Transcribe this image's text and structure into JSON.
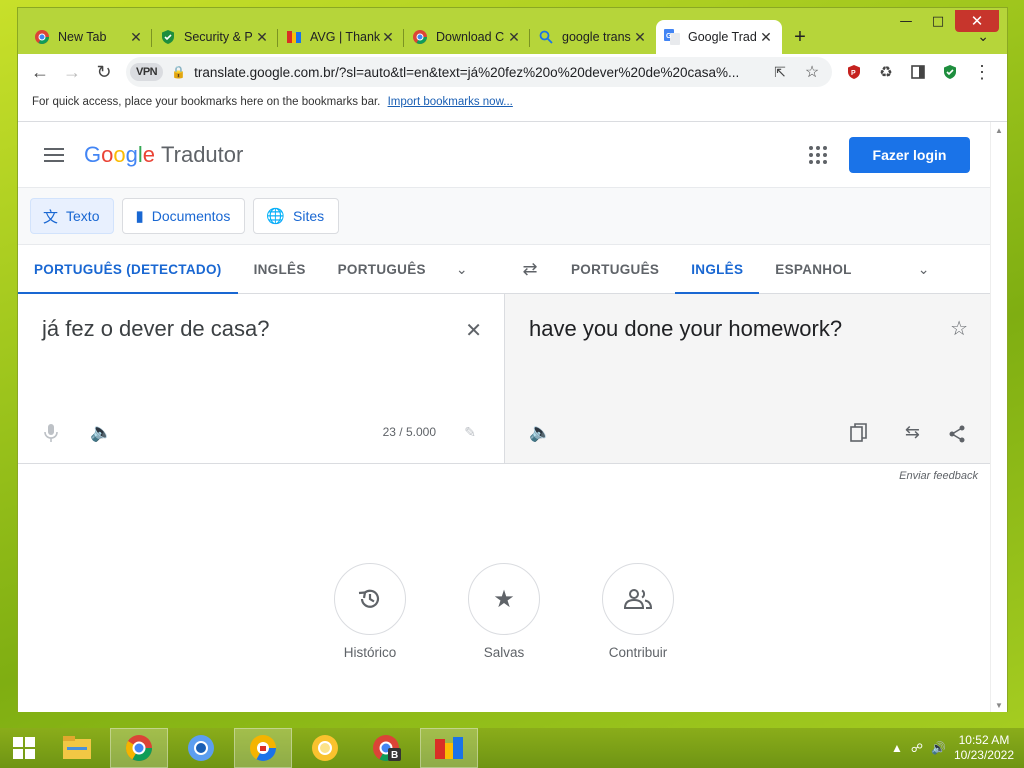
{
  "tabs": [
    {
      "title": "New Tab",
      "icon": "chrome-icon"
    },
    {
      "title": "Security & P",
      "icon": "shield-icon"
    },
    {
      "title": "AVG | Thank",
      "icon": "avg-icon"
    },
    {
      "title": "Download C",
      "icon": "chrome-icon"
    },
    {
      "title": "google trans",
      "icon": "search-icon"
    },
    {
      "title": "Google Trad",
      "icon": "google-translate-icon"
    }
  ],
  "omnibox": {
    "vpn_label": "VPN",
    "url": "translate.google.com.br/?sl=auto&tl=en&text=já%20fez%20o%20dever%20de%20casa%..."
  },
  "bookmarks": {
    "message": "For quick access, place your bookmarks here on the bookmarks bar.",
    "import_link": "Import bookmarks now..."
  },
  "header": {
    "logo_parts": [
      "G",
      "o",
      "o",
      "g",
      "l",
      "e"
    ],
    "product": "Tradutor",
    "login_label": "Fazer login"
  },
  "modes": [
    {
      "label": "Texto",
      "icon": "translate-icon"
    },
    {
      "label": "Documentos",
      "icon": "document-icon"
    },
    {
      "label": "Sites",
      "icon": "globe-icon"
    }
  ],
  "source_langs": [
    "PORTUGUÊS (DETECTADO)",
    "INGLÊS",
    "PORTUGUÊS"
  ],
  "target_langs": [
    "PORTUGUÊS",
    "INGLÊS",
    "ESPANHOL"
  ],
  "source": {
    "text": "já fez o dever de casa?",
    "count": "23 / 5.000"
  },
  "target": {
    "text": "have you done your homework?"
  },
  "feedback": "Enviar feedback",
  "actions": [
    {
      "label": "Histórico",
      "icon": "history-icon"
    },
    {
      "label": "Salvas",
      "icon": "star-icon"
    },
    {
      "label": "Contribuir",
      "icon": "people-icon"
    }
  ],
  "clock": {
    "time": "10:52 AM",
    "date": "10/23/2022"
  },
  "colors": {
    "accent": "#1a73e8",
    "desktop": "#9cc41c",
    "close": "#c7352c"
  }
}
